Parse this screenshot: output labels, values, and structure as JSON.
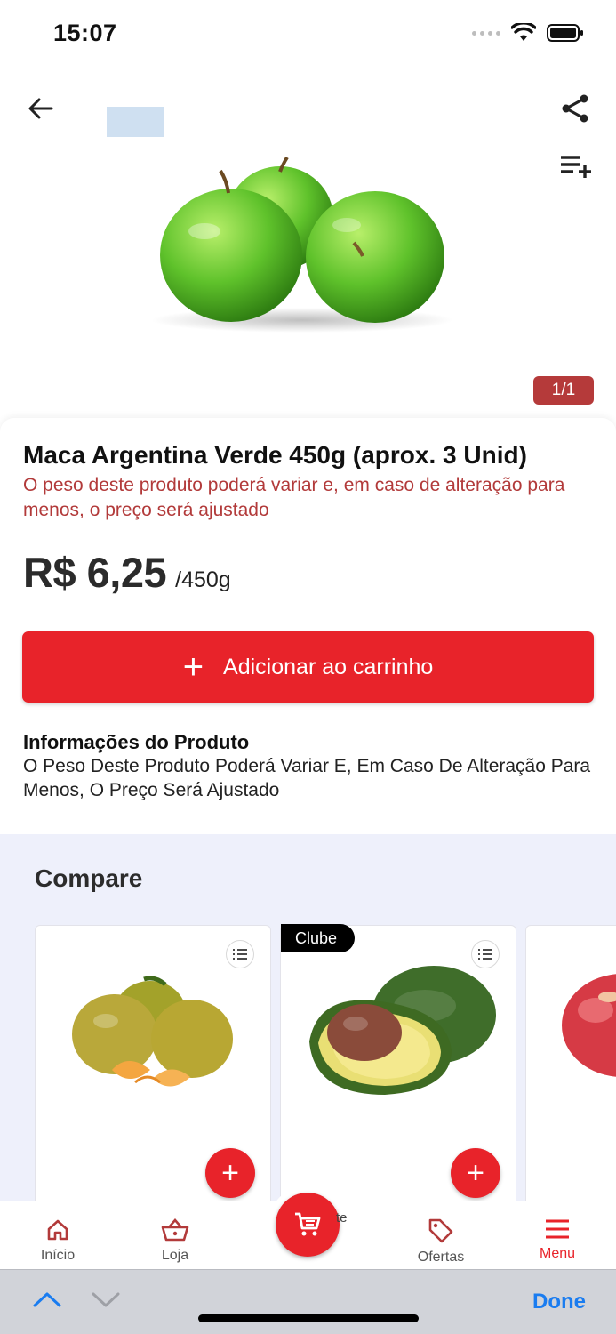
{
  "status": {
    "time": "15:07"
  },
  "product": {
    "image_counter": "1/1",
    "title": "Maca Argentina Verde 450g (aprox. 3 Unid)",
    "weight_note": "O peso deste produto poderá variar e, em caso de alteração para menos, o preço será ajustado",
    "price": "R$ 6,25",
    "unit": "/450g",
    "add_to_cart_label": "Adicionar ao carrinho",
    "info_title": "Informações do Produto",
    "info_text": "O Peso Deste Produto Poderá Variar E, Em Caso De Alteração Para Menos, O Preço Será Ajustado"
  },
  "compare": {
    "title": "Compare",
    "cards": [
      {
        "image": "tangerines",
        "badge": ""
      },
      {
        "image": "avocado",
        "badge": "Clube",
        "partial_text": "te"
      },
      {
        "image": "red-apple",
        "badge": ""
      }
    ]
  },
  "bottom_nav": {
    "items": [
      {
        "label": "Início",
        "icon": "home-icon"
      },
      {
        "label": "Loja",
        "icon": "basket-icon"
      },
      {
        "label": "Ofertas",
        "icon": "tag-icon"
      },
      {
        "label": "Menu",
        "icon": "menu-icon"
      }
    ],
    "cart_icon": "cart-icon"
  },
  "keyboard_bar": {
    "done_label": "Done"
  },
  "colors": {
    "accent": "#e8232a",
    "counter_bg": "#b53a3a",
    "note": "#b23a3a",
    "compare_bg": "#eef0fb",
    "done": "#1a7cf0"
  }
}
